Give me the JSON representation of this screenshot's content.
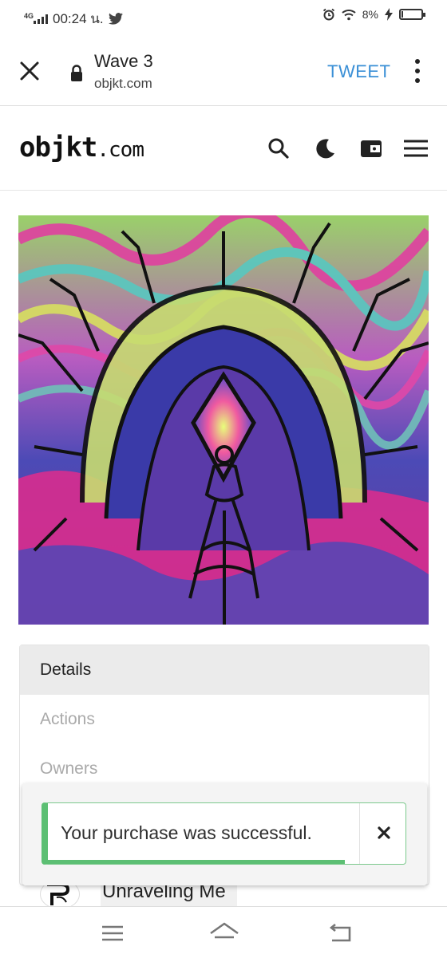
{
  "status_bar": {
    "network": "4G",
    "time": "00:24 น.",
    "twitter_icon": "twitter-bird-icon",
    "battery_percent_text": "8%",
    "battery_level": 0.08,
    "icons": [
      "alarm-icon",
      "wifi-icon",
      "charging-icon",
      "battery-icon"
    ]
  },
  "browser": {
    "page_title": "Wave 3",
    "url": "objkt.com",
    "action_label": "TWEET",
    "action_color": "#3a8fd6",
    "icons": [
      "close-icon",
      "lock-icon",
      "more-vert-icon"
    ]
  },
  "site": {
    "logo_main": "objkt",
    "logo_suffix": ".com",
    "icons": [
      "search-icon",
      "dark-mode-icon",
      "wallet-icon",
      "menu-icon"
    ]
  },
  "artwork": {
    "icon": "artwork-image"
  },
  "panel": {
    "tabs": [
      {
        "label": "Details",
        "active": true
      },
      {
        "label": "Actions",
        "active": false
      },
      {
        "label": "Owners",
        "active": false
      }
    ]
  },
  "toast": {
    "message": "Your purchase was successful.",
    "accent_color": "#5cbf73",
    "progress": 0.83,
    "close_icon": "close-icon"
  },
  "owner": {
    "name": "Unraveling Me",
    "avatar_icon": "avatar-image"
  },
  "nav": {
    "icons": [
      "recents-icon",
      "home-icon",
      "back-icon"
    ]
  }
}
